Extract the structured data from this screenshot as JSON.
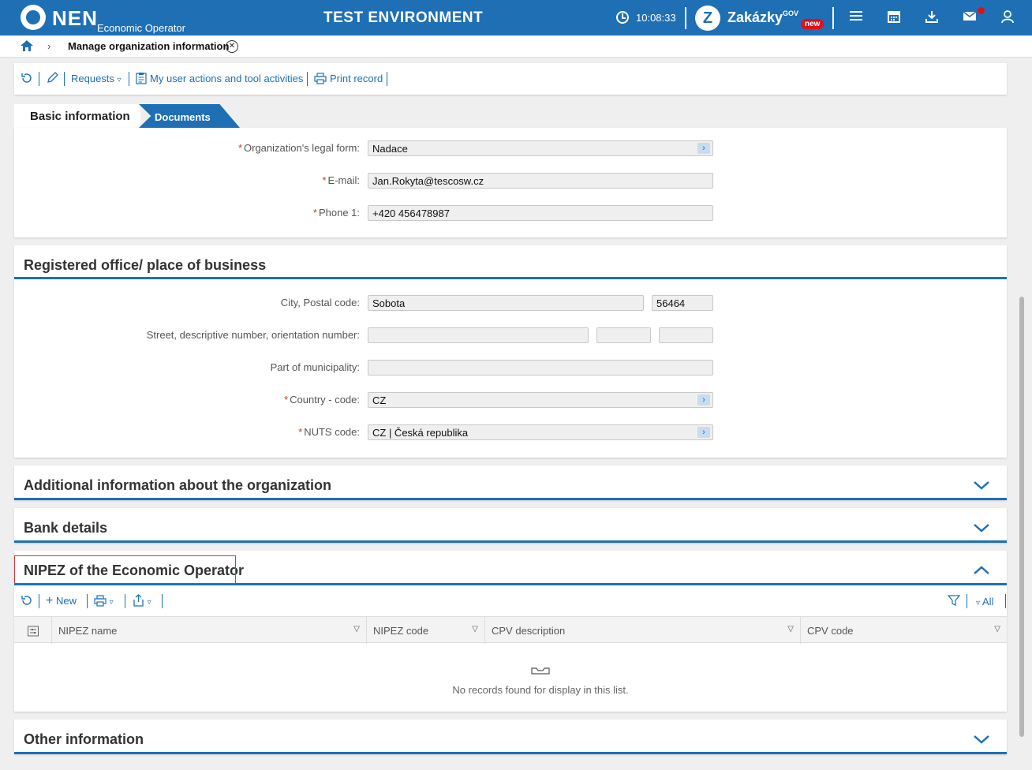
{
  "header": {
    "logo_text": "NEN",
    "logo_sub": "Economic Operator",
    "environment": "TEST ENVIRONMENT",
    "time": "10:08:33",
    "zakazky": "Zakázky",
    "zakazky_gov": "GOV",
    "zakazky_badge": "new"
  },
  "breadcrumb": {
    "title": "Manage organization information"
  },
  "toolbar": {
    "requests": "Requests",
    "my_actions": "My user actions and tool activities",
    "print": "Print record"
  },
  "tabs": {
    "basic": "Basic information",
    "documents": "Documents"
  },
  "basic": {
    "legal_form_label": "Organization's legal form:",
    "legal_form_value": "Nadace",
    "email_label": "E-mail:",
    "email_value": "Jan.Rokyta@tescosw.cz",
    "phone_label": "Phone 1:",
    "phone_value": "+420 456478987"
  },
  "office": {
    "title": "Registered office/ place of business",
    "city_label": "City, Postal code:",
    "city_value": "Sobota",
    "postal_value": "56464",
    "street_label": "Street, descriptive number, orientation number:",
    "part_label": "Part of municipality:",
    "country_label": "Country - code:",
    "country_value": "CZ",
    "nuts_label": "NUTS code:",
    "nuts_value": "CZ | Česká republika"
  },
  "sections": {
    "additional": "Additional information about the organization",
    "bank": "Bank details",
    "nipez": "NIPEZ of the Economic Operator",
    "other": "Other information"
  },
  "nipez_grid": {
    "new": "New",
    "all": "All",
    "columns": [
      "NIPEZ name",
      "NIPEZ code",
      "CPV description",
      "CPV code"
    ],
    "empty": "No records found for display in this list."
  }
}
